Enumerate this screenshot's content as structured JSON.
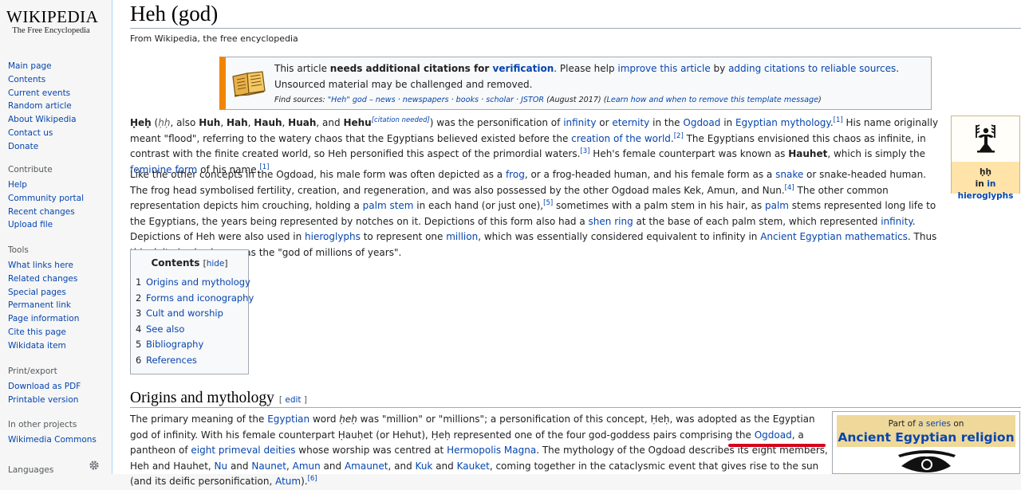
{
  "logo": {
    "wordmark": "WIKIPEDIA",
    "tagline": "The Free Encyclopedia"
  },
  "sidebar": {
    "nav": [
      "Main page",
      "Contents",
      "Current events",
      "Random article",
      "About Wikipedia",
      "Contact us",
      "Donate"
    ],
    "contribute": {
      "heading": "Contribute",
      "items": [
        "Help",
        "Community portal",
        "Recent changes",
        "Upload file"
      ]
    },
    "tools": {
      "heading": "Tools",
      "items": [
        "What links here",
        "Related changes",
        "Special pages",
        "Permanent link",
        "Page information",
        "Cite this page",
        "Wikidata item"
      ]
    },
    "print": {
      "heading": "Print/export",
      "items": [
        "Download as PDF",
        "Printable version"
      ]
    },
    "other": {
      "heading": "In other projects",
      "items": [
        "Wikimedia Commons"
      ]
    },
    "languages": {
      "heading": "Languages"
    }
  },
  "page": {
    "title": "Heh (god)",
    "subtitle": "From Wikipedia, the free encyclopedia"
  },
  "ambox": {
    "t1": "This article ",
    "t2": "needs additional citations for ",
    "t3": "verification",
    "t4": ". Please help ",
    "t5": "improve this article",
    "t6": " by ",
    "t7": "adding citations to reliable sources",
    "t8": ". Unsourced material may be challenged and removed.",
    "f1": "Find sources: ",
    "f2": "\"Heh\" god",
    "f3": " – ",
    "f4": "news",
    "f5": " · ",
    "f6": "newspapers",
    "f7": " · ",
    "f8": "books",
    "f9": " · ",
    "f10": "scholar",
    "f11": " · ",
    "f12": "JSTOR",
    "f13": " (August 2017) (",
    "f14": "Learn how and when to remove this template message",
    "f15": ")"
  },
  "para1": {
    "s1": "Ḥeḥ",
    "s2": " (",
    "s3": "ḥḥ",
    "s4": ", also ",
    "s5": "Huh",
    "s6": ", ",
    "s7": "Hah",
    "s8": ", ",
    "s9": "Hauh",
    "s10": ", ",
    "s11": "Huah",
    "s12": ", and ",
    "s13": "Hehu",
    "s14": "[citation needed]",
    "s15": ") was the personification of ",
    "s16": "infinity",
    "s17": " or ",
    "s18": "eternity",
    "s19": " in the ",
    "s20": "Ogdoad",
    "s21": " in ",
    "s22": "Egyptian mythology",
    "s23": ".",
    "s24": "[1]",
    "s25": " His name originally meant \"flood\", referring to the watery chaos that the Egyptians believed existed before the ",
    "s26": "creation of the world",
    "s27": ".",
    "s28": "[2]",
    "s29": " The Egyptians envisioned this chaos as infinite, in contrast with the finite created world, so Heh personified this aspect of the primordial waters.",
    "s30": "[3]",
    "s31": " Heh's female counterpart was known as ",
    "s32": "Hauhet",
    "s33": ", which is simply the ",
    "s34": "feminine form",
    "s35": " of his name.",
    "s36": "[1]"
  },
  "para2": {
    "s1": "Like the other concepts in the Ogdoad, his male form was often depicted as a ",
    "s2": "frog",
    "s3": ", or a frog-headed human, and his female form as a ",
    "s4": "snake",
    "s5": " or snake-headed human. The frog head symbolised fertility, creation, and regeneration, and was also possessed by the other Ogdoad males Kek, Amun, and Nun.",
    "s6": "[4]",
    "s7": " The other common representation depicts him crouching, holding a ",
    "s8": "palm stem",
    "s9": " in each hand (or just one),",
    "s10": "[5]",
    "s11": " sometimes with a palm stem in his hair, as ",
    "s12": "palm",
    "s13": " stems represented long life to the Egyptians, the years being represented by notches on it. Depictions of this form also had a ",
    "s14": "shen ring",
    "s15": " at the base of each palm stem, which represented ",
    "s16": "infinity",
    "s17": ". Depictions of Heh were also used in ",
    "s18": "hieroglyphs",
    "s19": " to represent one ",
    "s20": "million",
    "s21": ", which was essentially considered equivalent to infinity in ",
    "s22": "Ancient Egyptian mathematics",
    "s23": ". Thus this deity is also known as the \"god of millions of years\"."
  },
  "infobox": {
    "translit": "ḥḥ",
    "caption": "in hieroglyphs"
  },
  "toc": {
    "title": "Contents",
    "hide_open": "[",
    "hide": "hide",
    "hide_close": "]",
    "items": [
      {
        "num": "1",
        "label": "Origins and mythology"
      },
      {
        "num": "2",
        "label": "Forms and iconography"
      },
      {
        "num": "3",
        "label": "Cult and worship"
      },
      {
        "num": "4",
        "label": "See also"
      },
      {
        "num": "5",
        "label": "Bibliography"
      },
      {
        "num": "6",
        "label": "References"
      }
    ]
  },
  "section": {
    "title": "Origins and mythology",
    "edit_open": "[ ",
    "edit": "edit",
    "edit_close": " ]"
  },
  "para3": {
    "s1": "The primary meaning of the ",
    "s2": "Egyptian",
    "s3": " word ",
    "s4": "ḥeḥ",
    "s5": " was \"million\" or \"millions\"; a personification of this concept, Ḥeḥ, was adopted as the Egyptian god of infinity. With his female counterpart Ḥauḥet (or Hehut), Ḥeḥ represented one of the four god-goddess pairs comprising the ",
    "s6": "Ogdoad",
    "s7": ", a pantheon of ",
    "s8": "eight primeval deities",
    "s9": " whose worship was centred at ",
    "s10": "Hermopolis Magna",
    "s11": ". The mythology of the Ogdoad describes its eight members, Heh and Hauhet, ",
    "s12": "Nu",
    "s13": " and ",
    "s14": "Naunet",
    "s15": ", ",
    "s16": "Amun",
    "s17": " and ",
    "s18": "Amaunet",
    "s19": ", and ",
    "s20": "Kuk",
    "s21": " and ",
    "s22": "Kauket",
    "s23": ", coming together in the cataclysmic event that gives rise to the sun (and its deific personification, ",
    "s24": "Atum",
    "s25": ").",
    "s26": "[6]"
  },
  "series": {
    "pre1": "Part of ",
    "pre2": "a series",
    "pre3": " on",
    "title": "Ancient Egyptian religion"
  },
  "colors": {
    "link": "#0645ad",
    "ambox_stripe": "#f28500",
    "infobox_caption_bg": "#ffe3a8",
    "series_header_bg": "#eed89a",
    "annotation_red": "#d6001c"
  },
  "icons": [
    "book-icon",
    "heh-hieroglyph-icon",
    "gear-icon",
    "eye-of-horus-icon"
  ]
}
